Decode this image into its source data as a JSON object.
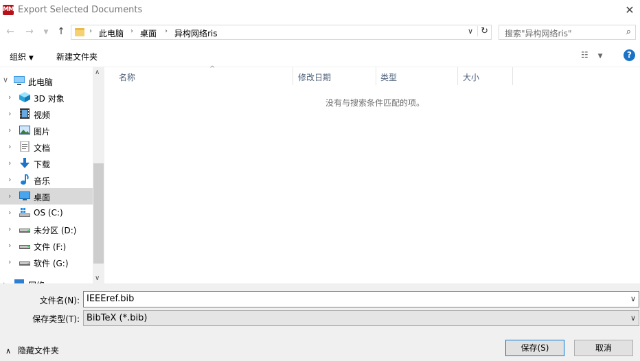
{
  "window": {
    "title": "Export Selected Documents",
    "app_logo_text": "MM"
  },
  "nav": {
    "back_icon": "arrow-left-icon",
    "forward_icon": "arrow-right-icon",
    "recent_icon": "chevron-down-icon",
    "up_icon": "arrow-up-icon",
    "breadcrumb": [
      "此电脑",
      "桌面",
      "异构网络ris"
    ]
  },
  "search": {
    "placeholder": "搜索\"异构网络ris\""
  },
  "toolbar": {
    "organize_label": "组织",
    "new_folder_label": "新建文件夹"
  },
  "tree": [
    {
      "label": "此电脑",
      "icon": "computer-icon",
      "expanded": true
    },
    {
      "label": "3D 对象",
      "icon": "cube-3d-icon"
    },
    {
      "label": "视频",
      "icon": "video-icon"
    },
    {
      "label": "图片",
      "icon": "picture-icon"
    },
    {
      "label": "文档",
      "icon": "document-icon"
    },
    {
      "label": "下载",
      "icon": "download-icon"
    },
    {
      "label": "音乐",
      "icon": "music-icon"
    },
    {
      "label": "桌面",
      "icon": "desktop-icon",
      "selected": true
    },
    {
      "label": "OS (C:)",
      "icon": "os-drive-icon"
    },
    {
      "label": "未分区 (D:)",
      "icon": "drive-icon"
    },
    {
      "label": "文件 (F:)",
      "icon": "drive-icon"
    },
    {
      "label": "软件 (G:)",
      "icon": "drive-icon"
    },
    {
      "label": "网络",
      "icon": "network-icon"
    }
  ],
  "columns": [
    "名称",
    "修改日期",
    "类型",
    "大小"
  ],
  "empty_message": "没有与搜索条件匹配的项。",
  "form": {
    "filename_label": "文件名(N):",
    "filename_value": "IEEEref.bib",
    "filetype_label": "保存类型(T):",
    "filetype_value": "BibTeX (*.bib)"
  },
  "hide_folders_label": "隐藏文件夹",
  "buttons": {
    "save": "保存(S)",
    "cancel": "取消"
  }
}
